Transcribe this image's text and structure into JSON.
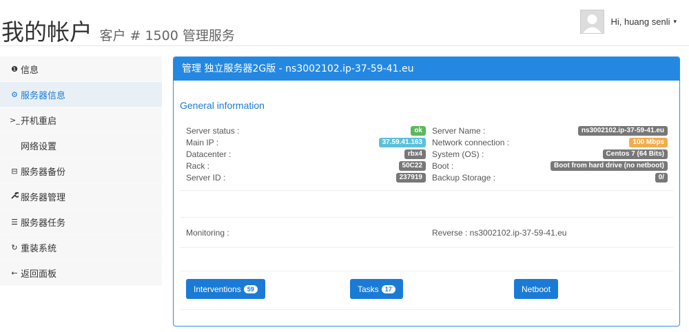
{
  "header": {
    "title": "我的帐户",
    "subtitle": "客户 # 1500 管理服务",
    "user_greeting": "Hi, huang senli",
    "caret": "▾"
  },
  "sidebar": {
    "items": [
      {
        "icon": "info-circle-icon",
        "glyph": "❶",
        "label": "信息"
      },
      {
        "icon": "tachometer-icon",
        "glyph": "⚙",
        "label": "服务器信息"
      },
      {
        "icon": "terminal-icon",
        "glyph": ">_",
        "label": "开机重启"
      },
      {
        "icon": "",
        "glyph": "",
        "label": "网络设置"
      },
      {
        "icon": "hdd-icon",
        "glyph": "⊟",
        "label": "服务器备份"
      },
      {
        "icon": "wrench-icon",
        "glyph": "🔧",
        "label": "服务器管理"
      },
      {
        "icon": "tasks-icon",
        "glyph": "☰",
        "label": "服务器任务"
      },
      {
        "icon": "refresh-icon",
        "glyph": "↻",
        "label": "重装系统"
      },
      {
        "icon": "arrow-left-icon",
        "glyph": "←",
        "label": "返回面板"
      }
    ],
    "active_index": 1
  },
  "panel": {
    "heading": "管理 独立服务器2G版 - ns3002102.ip-37-59-41.eu",
    "section_title": "General information",
    "left_rows": [
      {
        "label": "Server status :",
        "value": "ok",
        "color": "green"
      },
      {
        "label": "Main IP :",
        "value": "37.59.41.163",
        "color": "blue"
      },
      {
        "label": "Datacenter :",
        "value": "rbx4",
        "color": "gray"
      },
      {
        "label": "Rack :",
        "value": "50C22",
        "color": "gray"
      },
      {
        "label": "Server ID :",
        "value": "237919",
        "color": "gray"
      }
    ],
    "right_rows": [
      {
        "label": "Server Name :",
        "value": "ns3002102.ip-37-59-41.eu",
        "color": "gray"
      },
      {
        "label": "Network connection :",
        "value": "100 Mbps",
        "color": "orange"
      },
      {
        "label": "System (OS) :",
        "value": "Centos 7 (64 Bits)",
        "color": "gray"
      },
      {
        "label": "Boot :",
        "value": "Boot from hard drive (no netboot)",
        "color": "gray"
      },
      {
        "label": "Backup Storage :",
        "value": "0/",
        "color": "gray"
      }
    ],
    "monitoring_label": "Monitoring :",
    "reverse_text": "Reverse : ns3002102.ip-37-59-41.eu",
    "buttons": {
      "interventions": {
        "label": "Interventions",
        "count": "59"
      },
      "tasks": {
        "label": "Tasks",
        "count": "17"
      },
      "netboot": {
        "label": "Netboot"
      }
    }
  },
  "colors": {
    "accent": "#2488e2",
    "ok": "#5cb85c",
    "info": "#5bc0de",
    "warning": "#f0ad4e",
    "muted": "#777777"
  }
}
